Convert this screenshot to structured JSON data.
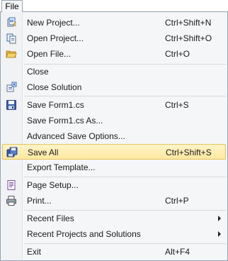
{
  "menubar": {
    "file_label": "File"
  },
  "menu": {
    "items": [
      {
        "label": "New Project...",
        "shortcut": "Ctrl+Shift+N",
        "icon": "new-project-icon"
      },
      {
        "label": "Open Project...",
        "shortcut": "Ctrl+Shift+O",
        "icon": "open-project-icon"
      },
      {
        "label": "Open File...",
        "shortcut": "Ctrl+O",
        "icon": "open-file-icon"
      },
      {
        "label": "Close",
        "shortcut": ""
      },
      {
        "label": "Close Solution",
        "shortcut": "",
        "icon": "close-solution-icon"
      },
      {
        "label": "Save Form1.cs",
        "shortcut": "Ctrl+S",
        "icon": "save-icon"
      },
      {
        "label": "Save Form1.cs As...",
        "shortcut": ""
      },
      {
        "label": "Advanced Save Options...",
        "shortcut": ""
      },
      {
        "label": "Save All",
        "shortcut": "Ctrl+Shift+S",
        "icon": "save-all-icon",
        "highlighted": true
      },
      {
        "label": "Export Template...",
        "shortcut": ""
      },
      {
        "label": "Page Setup...",
        "shortcut": "",
        "icon": "page-setup-icon"
      },
      {
        "label": "Print...",
        "shortcut": "Ctrl+P",
        "icon": "print-icon"
      },
      {
        "label": "Recent Files",
        "shortcut": "",
        "submenu": true
      },
      {
        "label": "Recent Projects and Solutions",
        "shortcut": "",
        "submenu": true
      },
      {
        "label": "Exit",
        "shortcut": "Alt+F4"
      }
    ]
  },
  "colors": {
    "highlight": "#fde8a0",
    "highlight_border": "#e6c35f",
    "menu_background": "#f5f6f7"
  }
}
